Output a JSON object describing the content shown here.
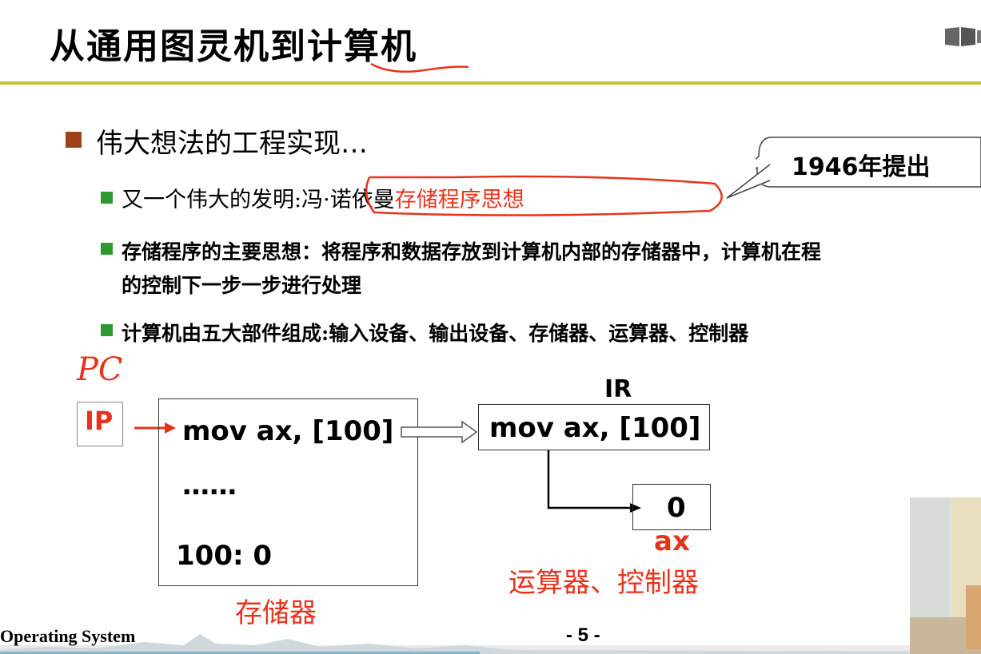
{
  "slide": {
    "title": "从通用图灵机到计算机",
    "bullet1": "伟大想法的工程实现…",
    "sub1_prefix": "又一个伟大的发明:",
    "sub1_name": "冯·诺依曼",
    "sub1_highlight": "存储程序思想",
    "sub2_line1": "存储程序的主要思想：将程序和数据存放到计算机内部的存储器中，计算机在程",
    "sub2_line2": "的控制下一步一步进行处理",
    "sub3": "计算机由五大部件组成:输入设备、输出设备、存储器、运算器、控制器",
    "callout": "1946年提出"
  },
  "diagram": {
    "handwritten_pc": "PC",
    "ip_label": "IP",
    "mem_line1": "mov ax, [100]",
    "mem_line2": "……",
    "mem_line3": "100:   0",
    "mem_label": "存储器",
    "ir_label": "IR",
    "ir_content": "mov ax, [100]",
    "ax_value": "0",
    "ax_label": "ax",
    "alu_label": "运算器、控制器"
  },
  "footer": {
    "course": "Operating System",
    "page": "- 5 -"
  },
  "colors": {
    "accent_red": "#e8331c",
    "rule_olive": "#c9be3f",
    "bullet_brown": "#a0401a",
    "bullet_green": "#2e9a2e"
  }
}
